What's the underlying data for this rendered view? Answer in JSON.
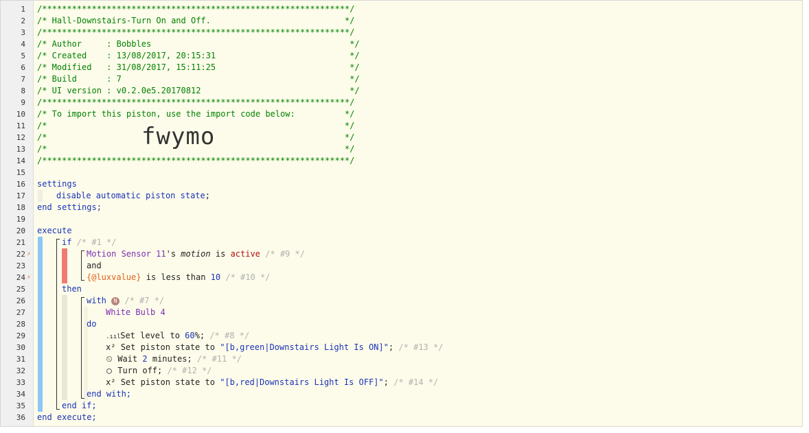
{
  "line_numbers": [
    "1",
    "2",
    "3",
    "4",
    "5",
    "6",
    "7",
    "8",
    "9",
    "10",
    "11",
    "12",
    "13",
    "14",
    "15",
    "16",
    "17",
    "18",
    "19",
    "20",
    "21",
    "22",
    "23",
    "24",
    "25",
    "26",
    "27",
    "28",
    "29",
    "30",
    "31",
    "32",
    "33",
    "34",
    "35",
    "36"
  ],
  "header": {
    "l1": "/**************************************************************/",
    "l2": "/* Hall-Downstairs-Turn On and Off.                           */",
    "l3": "/**************************************************************/",
    "l4": "/* Author     : Bobbles                                        */",
    "l5": "/* Created    : 13/08/2017, 20:15:31                           */",
    "l6": "/* Modified   : 31/08/2017, 15:11:25                           */",
    "l7": "/* Build      : 7                                              */",
    "l8": "/* UI version : v0.2.0e5.20170812                              */",
    "l9": "/**************************************************************/",
    "l10": "/* To import this piston, use the import code below:          */",
    "l11": "/*                                                            */",
    "l12": "/*                                                            */",
    "l13": "/*                                                            */",
    "l14": "/**************************************************************/",
    "import_code": "fwymo"
  },
  "settings": {
    "open": "settings",
    "disable": "disable automatic piston state",
    "semi": ";",
    "close": "end settings;"
  },
  "execute": {
    "open": "execute",
    "if": "if",
    "if_comment": "/* #1 */",
    "cond1_device": "Motion Sensor 11",
    "cond1_pos": "'s",
    "cond1_attr": "motion",
    "cond1_is": "is",
    "cond1_val": "active",
    "cond1_comment": "/* #9 */",
    "and": "and",
    "cond2_var": "{@luxvalue}",
    "cond2_op": "is less than",
    "cond2_val": "10",
    "cond2_comment": "/* #10 */",
    "then": "then",
    "with": "with",
    "with_badge": "N",
    "with_comment": "/* #7 */",
    "device": "White Bulb 4",
    "do": "do",
    "a1_icon": ".ııl",
    "a1_text": "Set level to",
    "a1_val": "60",
    "a1_suffix": "%;",
    "a1_comment": "/* #8 */",
    "a2_icon": "x²",
    "a2_text": "Set piston state to",
    "a2_val": "\"[b,green|Downstairs Light Is ON]\"",
    "a2_suffix": ";",
    "a2_comment": "/* #13 */",
    "a3_icon": "⏲",
    "a3_text": "Wait",
    "a3_val": "2",
    "a3_suffix": "minutes;",
    "a3_comment": "/* #11 */",
    "a4_icon": "◯",
    "a4_text": "Turn off;",
    "a4_comment": "/* #12 */",
    "a5_icon": "x²",
    "a5_text": "Set piston state to",
    "a5_val": "\"[b,red|Downstairs Light Is OFF]\"",
    "a5_suffix": ";",
    "a5_comment": "/* #14 */",
    "end_with": "end with;",
    "end_if": "end if;",
    "close": "end execute;"
  },
  "bolt_icon": "⚡",
  "colors": {
    "comment": "#008000",
    "keyword": "#1a33b8",
    "device": "#7b2fb8",
    "variable": "#e0621e",
    "value_red": "#b01010",
    "bar_blue": "#8ec6f5",
    "bar_red": "#f07b74",
    "bar_light": "#e8e8d8"
  }
}
